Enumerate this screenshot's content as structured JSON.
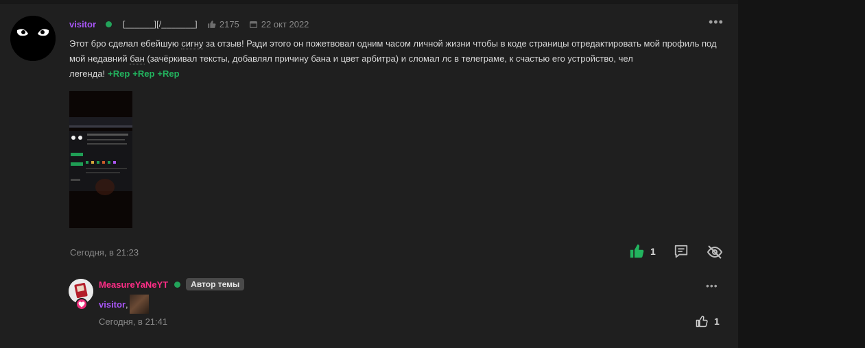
{
  "post": {
    "username": "visitor",
    "title_tag": "[______][/_______]",
    "likes_total": "2175",
    "join_date": "22 окт 2022",
    "text_part1": "Этот бро сделал ебейшую ",
    "text_abbr1": "сигну",
    "text_part2": " за отзыв! Ради этого он пожетвовал одним часом личной жизни чтобы в коде страницы отредактировать мой профиль под мой недавний ",
    "text_abbr2": "бан",
    "text_part3": " (зачёркивал тексты, добавлял причину бана и цвет арбитра) и сломал лс в телеграме, к счастью его устройство, чел легенда!",
    "reps": [
      "+Rep",
      "+Rep",
      "+Rep"
    ],
    "date": "Сегодня, в 21:23",
    "like_count": "1",
    "colors": {
      "username": "#a855f7",
      "rep": "#22b35e",
      "online": "#22a35a",
      "like_icon": "#22b35e"
    },
    "icons": [
      "thumbs-up-icon",
      "calendar-icon",
      "like-icon",
      "comment-icon",
      "hide-icon",
      "more-icon"
    ]
  },
  "reply": {
    "username": "MeasureYaNeYT",
    "author_badge": "Автор темы",
    "mention": "visitor",
    "comma": ",",
    "date": "Сегодня, в 21:41",
    "like_count": "1",
    "colors": {
      "username": "#ff2d87",
      "badge_bg": "#4a4a4a",
      "heart": "#ec2e7a"
    }
  }
}
